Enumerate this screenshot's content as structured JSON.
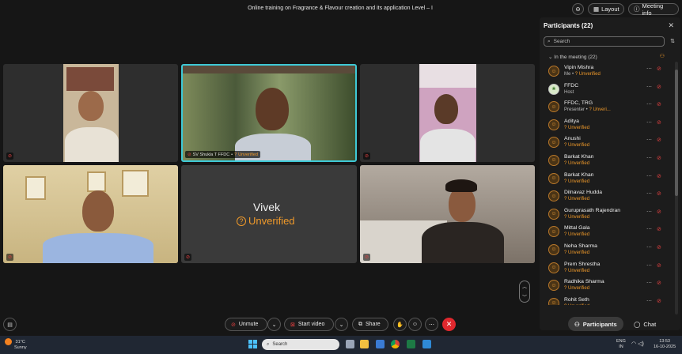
{
  "meeting": {
    "title": "Online training on Fragrance & Flavour creation and its application Level – I",
    "zoom_icon": "zoom-icon",
    "layout_label": "Layout",
    "meeting_info_label": "Meeting info"
  },
  "tiles": {
    "speaker_name": "SV Shukla T FFDC",
    "speaker_status": "Unverified",
    "vivek_name": "Vivek",
    "vivek_status": "Unverified"
  },
  "controls": {
    "unmute_label": "Unmute",
    "start_video_label": "Start video",
    "share_label": "Share",
    "participants_tab": "Participants",
    "chat_tab": "Chat"
  },
  "panel": {
    "title": "Participants (22)",
    "search_placeholder": "Search",
    "section_label": "In the meeting (22)",
    "participants": [
      {
        "name": "Vipin Mishra",
        "role": "Me",
        "status": "Unverified",
        "avatar": "person"
      },
      {
        "name": "FFDC",
        "role": "Host",
        "status": "",
        "avatar": "logo"
      },
      {
        "name": "FFDC, TRG",
        "role": "Presenter",
        "status": "Unveri...",
        "avatar": "person"
      },
      {
        "name": "Aditya",
        "role": "",
        "status": "Unverified",
        "avatar": "person"
      },
      {
        "name": "Anushi",
        "role": "",
        "status": "Unverified",
        "avatar": "person"
      },
      {
        "name": "Barkat Khan",
        "role": "",
        "status": "Unverified",
        "avatar": "person"
      },
      {
        "name": "Barkat Khan",
        "role": "",
        "status": "Unverified",
        "avatar": "person"
      },
      {
        "name": "Dilnavaz Hudda",
        "role": "",
        "status": "Unverified",
        "avatar": "person"
      },
      {
        "name": "Guruprasath Rajendran",
        "role": "",
        "status": "Unverified",
        "avatar": "person"
      },
      {
        "name": "Mittal Gala",
        "role": "",
        "status": "Unverified",
        "avatar": "person"
      },
      {
        "name": "Neha Sharma",
        "role": "",
        "status": "Unverified",
        "avatar": "person"
      },
      {
        "name": "Prem Shrestha",
        "role": "",
        "status": "Unverified",
        "avatar": "person"
      },
      {
        "name": "Radhika Sharma",
        "role": "",
        "status": "Unverified",
        "avatar": "person"
      },
      {
        "name": "Rohit Seth",
        "role": "",
        "status": "Unverified",
        "avatar": "person"
      }
    ]
  },
  "taskbar": {
    "weather_temp": "31°C",
    "weather_desc": "Sunny",
    "search_label": "Search",
    "lang_line1": "ENG",
    "lang_line2": "IN",
    "time": "13:53",
    "date": "16-10-2025"
  },
  "colors": {
    "accent_unverified": "#f09a2a",
    "active_speaker_border": "#3ec9d6",
    "end_call": "#e0282e"
  }
}
